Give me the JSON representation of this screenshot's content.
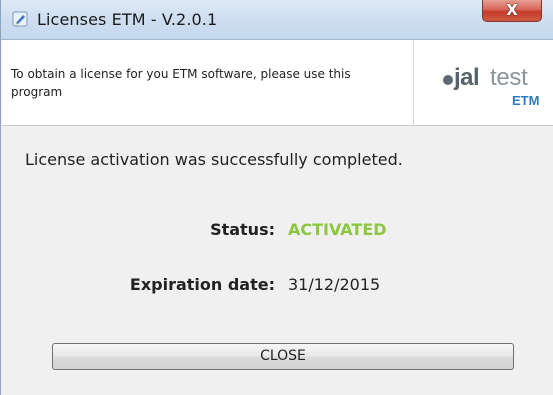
{
  "window": {
    "title": "Licenses ETM  -  V.2.0.1",
    "close_glyph": "X",
    "icon": "license-app-icon"
  },
  "header": {
    "instruction": "To obtain a license for you ETM software, please use this program",
    "logo": {
      "jal": "jal",
      "test": "test",
      "etm": "ETM"
    }
  },
  "body": {
    "message": "License activation was successfully completed.",
    "status_label": "Status:",
    "status_value": "ACTIVATED",
    "expiration_label": "Expiration date:",
    "expiration_value": "31/12/2015"
  },
  "actions": {
    "close_label": "CLOSE"
  },
  "colors": {
    "status_accent": "#8dc63f",
    "logo_blue": "#2f7bbf",
    "close_button_red": "#c43c2a"
  }
}
